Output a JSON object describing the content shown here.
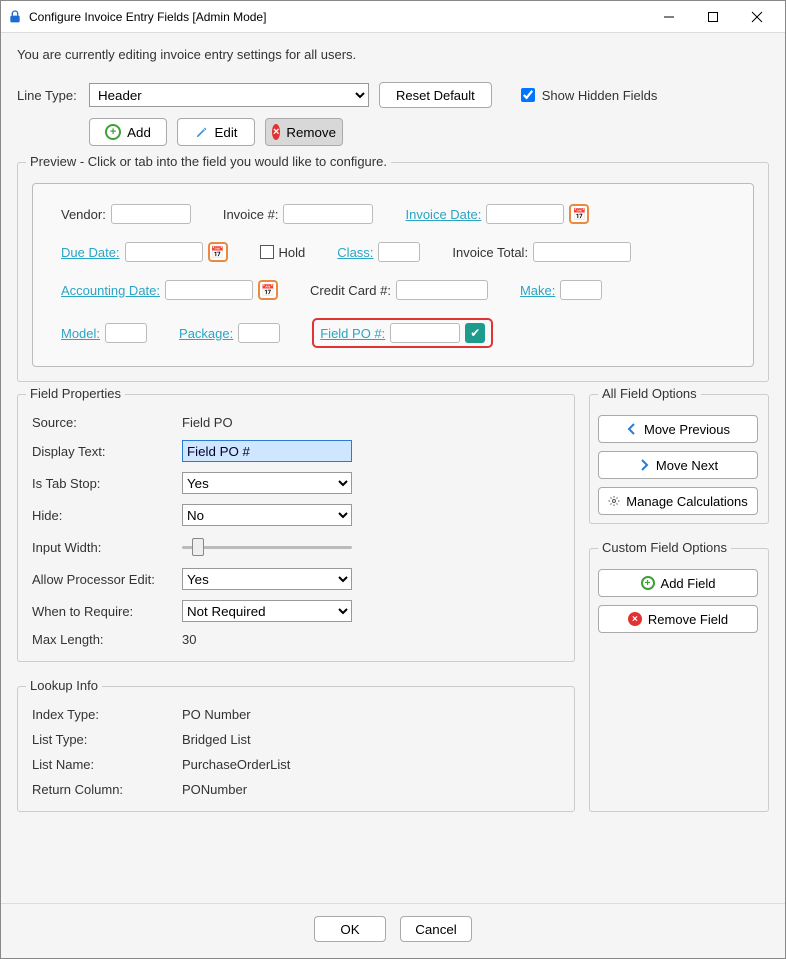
{
  "window": {
    "title": "Configure Invoice Entry Fields [Admin Mode]"
  },
  "intro": "You are currently editing invoice entry settings for all users.",
  "linetype_label": "Line Type:",
  "linetype_value": "Header",
  "reset_default": "Reset Default",
  "show_hidden_label": "Show Hidden Fields",
  "show_hidden_checked": true,
  "toolbar": {
    "add": "Add",
    "edit": "Edit",
    "remove": "Remove"
  },
  "preview": {
    "legend": "Preview - Click or tab into the field you would like to configure.",
    "fields": {
      "vendor": "Vendor:",
      "invoice_num": "Invoice #:",
      "invoice_date": "Invoice Date:",
      "due_date": "Due Date:",
      "hold": "Hold",
      "class": "Class:",
      "invoice_total": "Invoice Total:",
      "accounting_date": "Accounting Date:",
      "credit_card": "Credit Card #:",
      "make": "Make:",
      "model": "Model:",
      "package": "Package:",
      "field_po": "Field PO #:"
    }
  },
  "field_props": {
    "legend": "Field Properties",
    "source_label": "Source:",
    "source_value": "Field PO",
    "display_text_label": "Display Text:",
    "display_text_value": "Field PO #",
    "is_tab_stop_label": "Is Tab Stop:",
    "is_tab_stop_value": "Yes",
    "hide_label": "Hide:",
    "hide_value": "No",
    "input_width_label": "Input Width:",
    "allow_edit_label": "Allow Processor Edit:",
    "allow_edit_value": "Yes",
    "when_require_label": "When to Require:",
    "when_require_value": "Not Required",
    "max_length_label": "Max Length:",
    "max_length_value": "30"
  },
  "lookup": {
    "legend": "Lookup Info",
    "index_type_label": "Index Type:",
    "index_type_value": "PO Number",
    "list_type_label": "List Type:",
    "list_type_value": "Bridged List",
    "list_name_label": "List Name:",
    "list_name_value": "PurchaseOrderList",
    "return_col_label": "Return Column:",
    "return_col_value": "PONumber"
  },
  "all_field_options": {
    "legend": "All Field Options",
    "move_previous": "Move Previous",
    "move_next": "Move Next",
    "manage_calc": "Manage Calculations"
  },
  "custom_field_options": {
    "legend": "Custom Field Options",
    "add_field": "Add Field",
    "remove_field": "Remove Field"
  },
  "footer": {
    "ok": "OK",
    "cancel": "Cancel"
  }
}
